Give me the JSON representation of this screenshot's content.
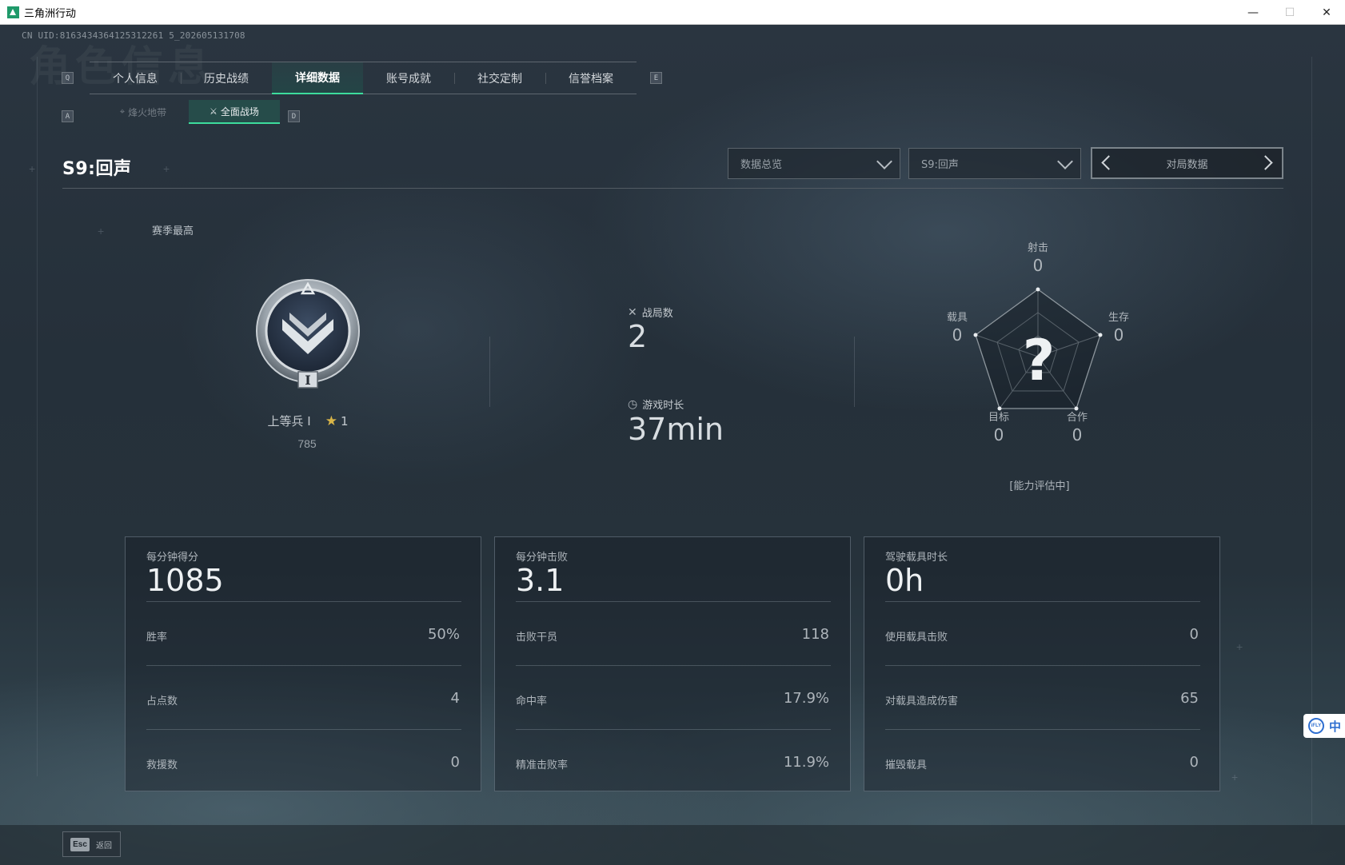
{
  "window": {
    "title": "三角洲行动",
    "minimize": "—",
    "maximize": "☐",
    "close": "✕"
  },
  "uid": "CN UID:8163434364125312261 5_202605131708",
  "keyhints": {
    "prev_tab": "Q",
    "next_tab": "E",
    "prev_sub": "A",
    "next_sub": "D"
  },
  "tabs": [
    {
      "label": "个人信息",
      "active": false
    },
    {
      "label": "历史战绩",
      "active": false
    },
    {
      "label": "详细数据",
      "active": true
    },
    {
      "label": "账号成就",
      "active": false
    },
    {
      "label": "社交定制",
      "active": false
    },
    {
      "label": "信誉档案",
      "active": false
    }
  ],
  "subtabs": [
    {
      "label": "烽火地带",
      "icon": "crosshair-icon",
      "active": false
    },
    {
      "label": "全面战场",
      "icon": "battlefield-icon",
      "active": true
    }
  ],
  "season": {
    "title": "S9:回声",
    "high_label": "赛季最高"
  },
  "filters": {
    "view": "数据总览",
    "season": "S9:回声",
    "pager_label": "对局数据"
  },
  "rank": {
    "name": "上等兵 I",
    "stars": "1",
    "score": "785"
  },
  "overview": {
    "matches_label": "战局数",
    "matches_value": "2",
    "time_label": "游戏时长",
    "time_value": "37min"
  },
  "radar": {
    "center": "?",
    "axes": [
      {
        "label": "射击",
        "value": "0"
      },
      {
        "label": "生存",
        "value": "0"
      },
      {
        "label": "合作",
        "value": "0"
      },
      {
        "label": "目标",
        "value": "0"
      },
      {
        "label": "载具",
        "value": "0"
      }
    ],
    "note": "[能力评估中]"
  },
  "cards": [
    {
      "header_label": "每分钟得分",
      "header_value": "1085",
      "rows": [
        {
          "label": "胜率",
          "value": "50%"
        },
        {
          "label": "占点数",
          "value": "4"
        },
        {
          "label": "救援数",
          "value": "0"
        }
      ]
    },
    {
      "header_label": "每分钟击败",
      "header_value": "3.1",
      "rows": [
        {
          "label": "击败干员",
          "value": "118"
        },
        {
          "label": "命中率",
          "value": "17.9%"
        },
        {
          "label": "精准击败率",
          "value": "11.9%"
        }
      ]
    },
    {
      "header_label": "驾驶载具时长",
      "header_value": "0h",
      "rows": [
        {
          "label": "使用载具击败",
          "value": "0"
        },
        {
          "label": "对载具造成伤害",
          "value": "65"
        },
        {
          "label": "摧毁载具",
          "value": "0"
        }
      ]
    }
  ],
  "footer": {
    "esc_key": "Esc",
    "esc_label": "返回"
  },
  "ime": {
    "logo": "iFLY",
    "mode": "中"
  }
}
